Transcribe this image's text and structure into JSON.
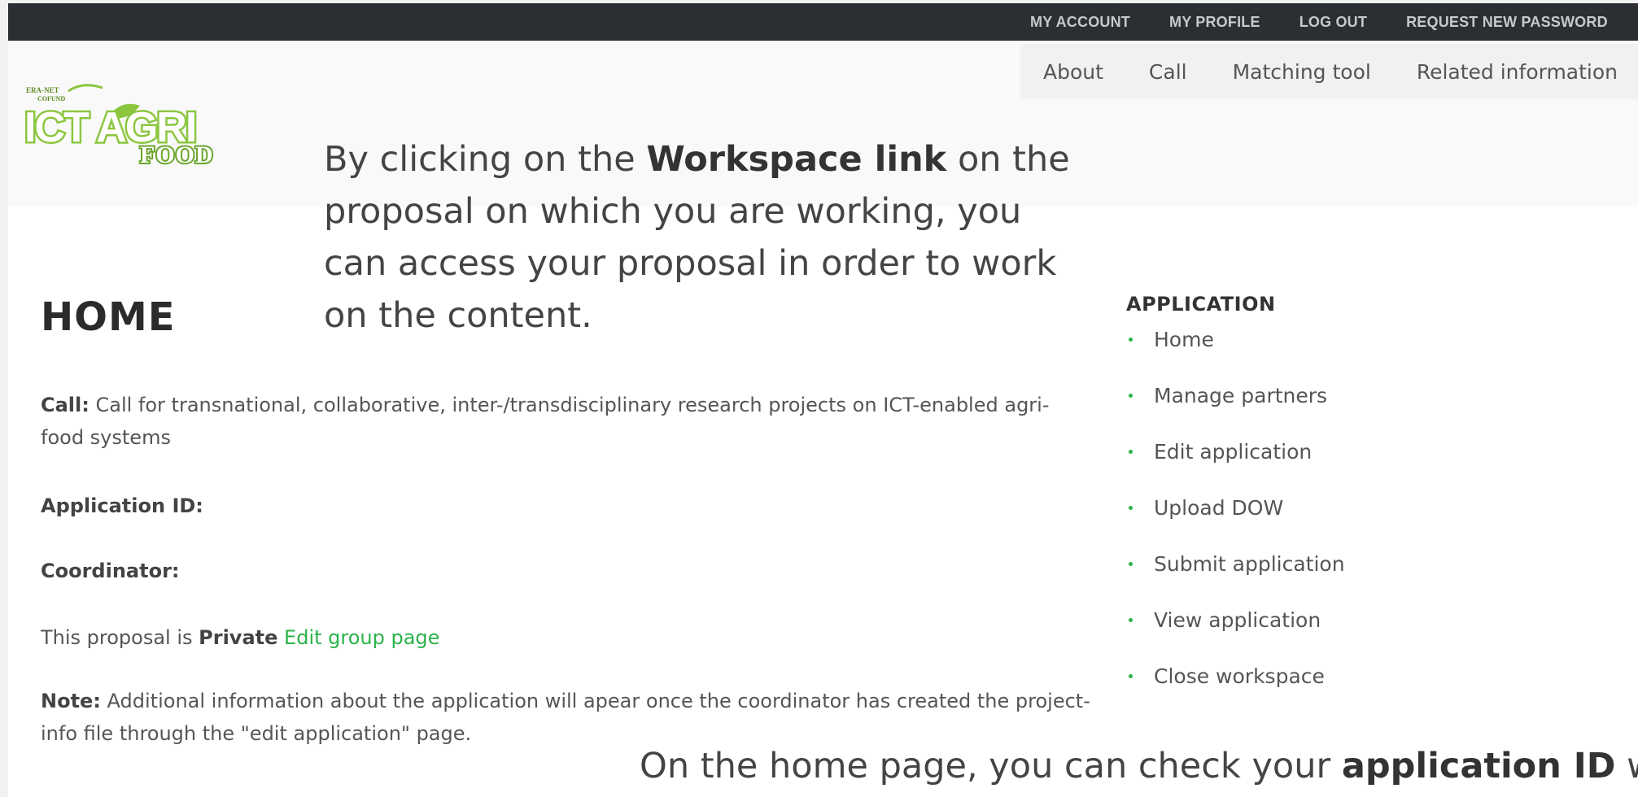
{
  "topbar": {
    "links": [
      "MY ACCOUNT",
      "MY PROFILE",
      "LOG OUT",
      "REQUEST NEW PASSWORD"
    ]
  },
  "logo": {
    "line1": "ERA-NET",
    "line2": "COFUND",
    "main": "ICT AGRI",
    "sub": "FOOD",
    "color": "#8cc63f"
  },
  "mainnav": {
    "items": [
      "About",
      "Call",
      "Matching tool",
      "Related information"
    ]
  },
  "annotation_top": {
    "before": "By clicking on the ",
    "bold": "Workspace link",
    "after": " on the proposal on which you are working, you can access your proposal in order to work on the content."
  },
  "content": {
    "title": "HOME",
    "call_label": "Call:",
    "call_value": " Call for transnational, collaborative, inter-/transdisciplinary research projects on ICT-enabled agri-food systems",
    "application_id_label": "Application ID:",
    "coordinator_label": "Coordinator:",
    "private_prefix": "This proposal is ",
    "private_value": "Private",
    "edit_group_link": "Edit group page",
    "note_label": "Note:",
    "note_value": " Additional information about the application will apear once the coordinator has created the project-info file through the \"edit application\" page."
  },
  "sidebar": {
    "title": "APPLICATION",
    "items": [
      "Home",
      "Manage partners",
      "Edit application",
      "Upload DOW",
      "Submit application",
      "View application",
      "Close workspace"
    ]
  },
  "annotation_bottom": {
    "before": "On the home page, you can check your ",
    "bold": "application ID",
    "after": " wh"
  },
  "colors": {
    "topbar_bg": "#2b2f33",
    "link_green": "#2bb34a",
    "logo_green": "#8cc63f"
  }
}
